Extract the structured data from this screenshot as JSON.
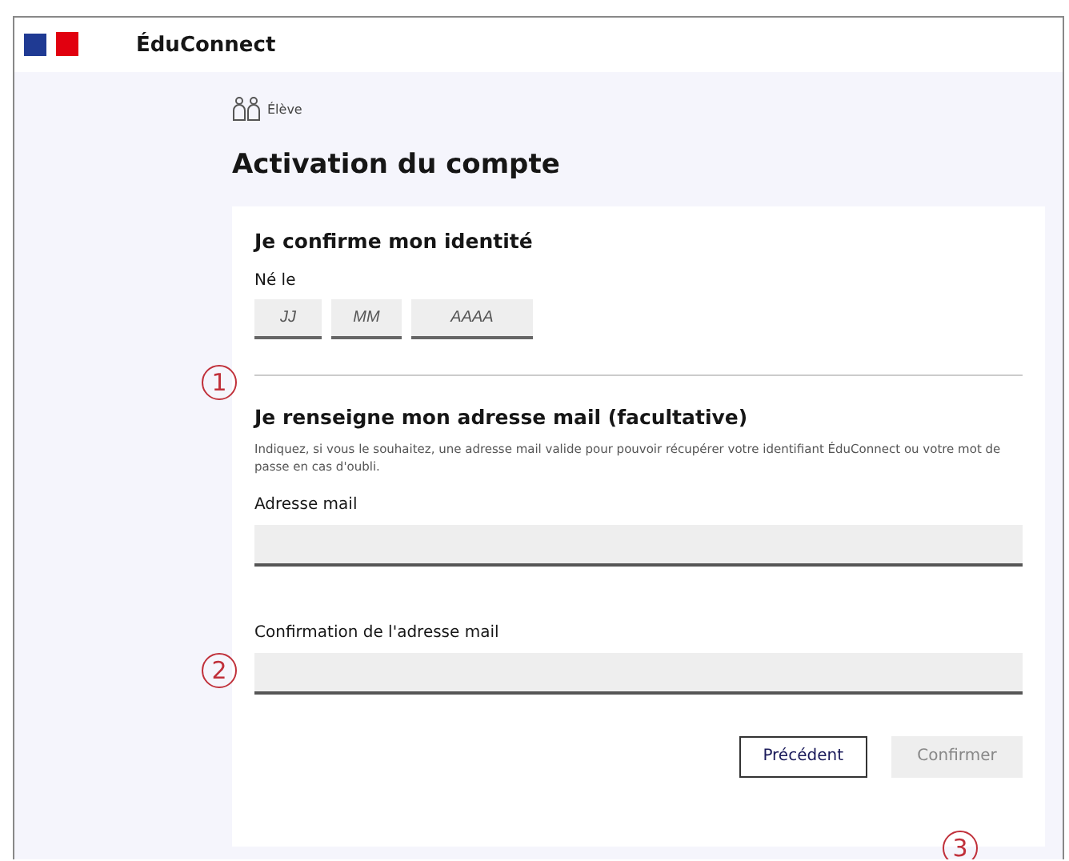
{
  "header": {
    "brand": "ÉduConnect"
  },
  "profile": {
    "label": "Élève"
  },
  "title": "Activation du compte",
  "identity": {
    "heading": "Je confirme mon identité",
    "birth_label": "Né le",
    "date_fields": [
      {
        "placeholder": "JJ"
      },
      {
        "placeholder": "MM"
      },
      {
        "placeholder": "AAAA"
      }
    ]
  },
  "email": {
    "heading": "Je renseigne mon adresse mail (facultative)",
    "help": "Indiquez, si vous le souhaitez, une adresse mail valide pour pouvoir récupérer votre identifiant ÉduConnect ou votre mot de passe en cas d'oubli.",
    "fields": [
      {
        "label": "Adresse mail"
      },
      {
        "label": "Confirmation de l'adresse mail"
      }
    ]
  },
  "buttons": [
    {
      "label": "Précédent",
      "disabled": false
    },
    {
      "label": "Confirmer",
      "disabled": true
    }
  ],
  "callouts": [
    "1",
    "2",
    "3"
  ]
}
